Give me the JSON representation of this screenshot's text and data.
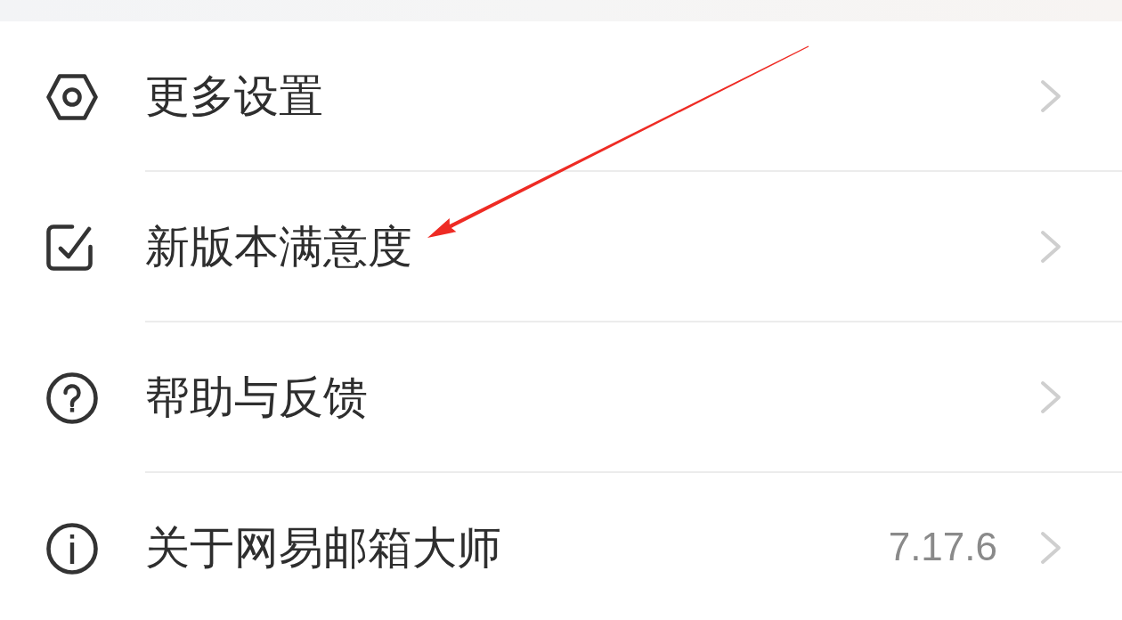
{
  "menu": {
    "items": [
      {
        "label": "更多设置",
        "arrow_marked": false
      },
      {
        "label": "新版本满意度",
        "arrow_marked": true
      },
      {
        "label": "帮助与反馈",
        "arrow_marked": false
      },
      {
        "label": "关于网易邮箱大师",
        "value": "7.17.6",
        "arrow_marked": false
      }
    ]
  }
}
